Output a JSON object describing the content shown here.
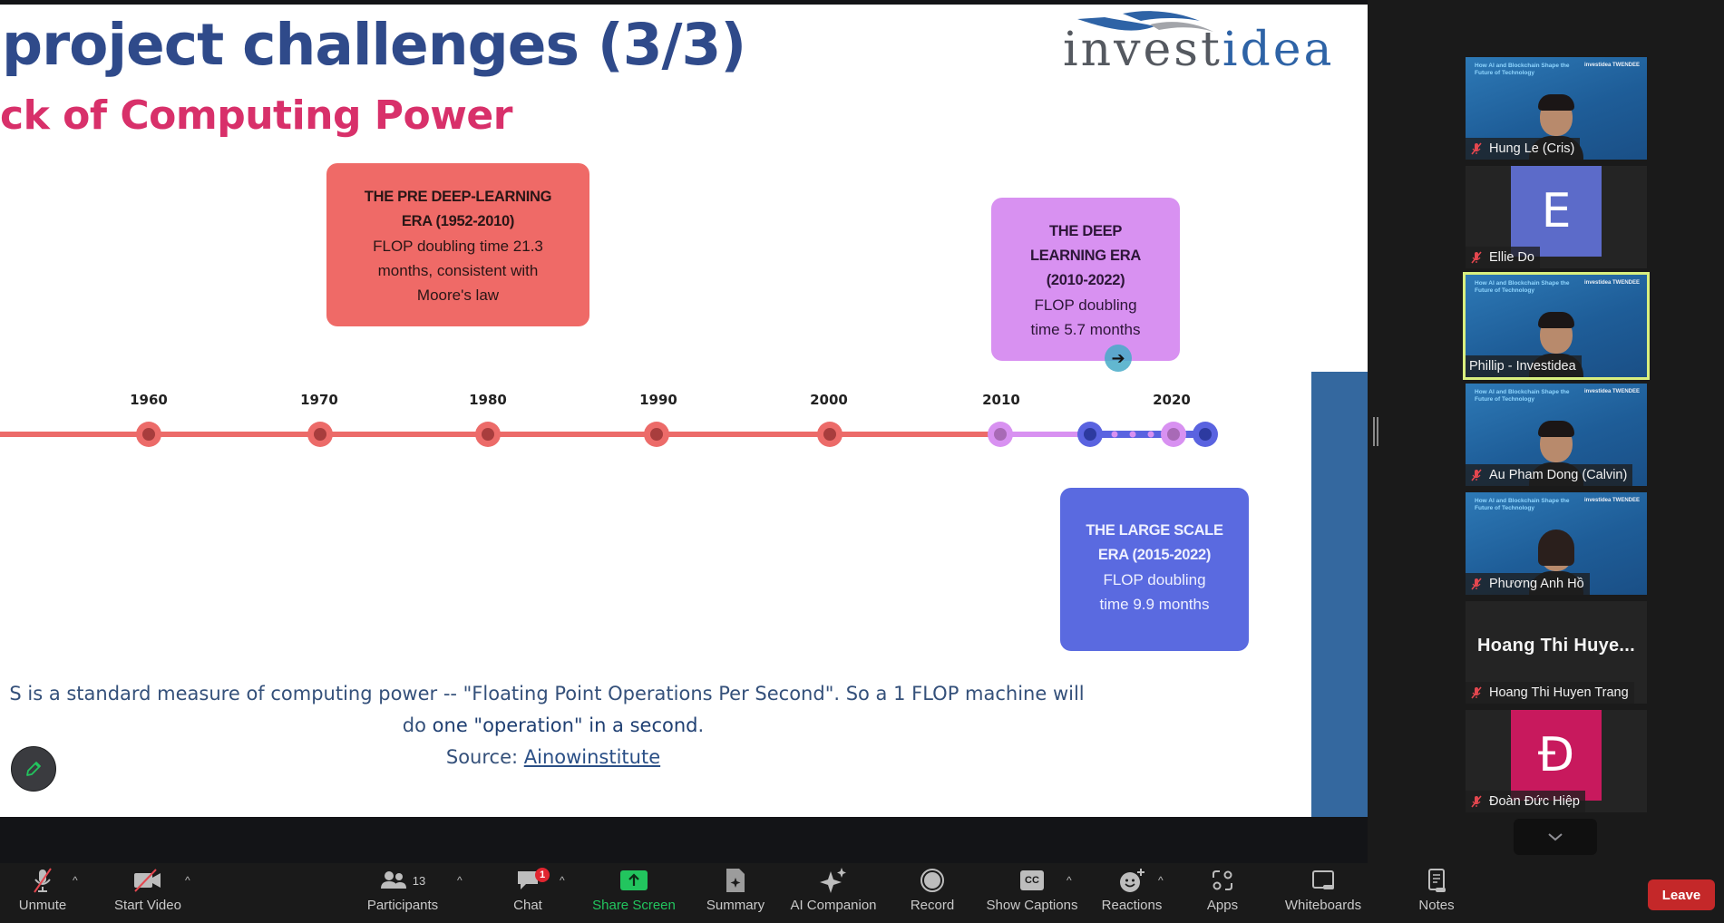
{
  "slide": {
    "title": "project challenges (3/3)",
    "subtitle": "ck of Computing Power",
    "logo": {
      "part1": "invest",
      "part2": "idea"
    },
    "cards": [
      {
        "id": "pre",
        "title_lines": [
          "THE PRE DEEP-LEARNING",
          "ERA (1952-2010)"
        ],
        "body_lines": [
          "FLOP doubling time 21.3",
          "months, consistent with",
          "Moore's law"
        ],
        "color": "#ef6a67"
      },
      {
        "id": "deep",
        "title_lines": [
          "THE DEEP",
          "LEARNING ERA",
          "(2010-2022)"
        ],
        "body_lines": [
          "FLOP doubling",
          "time 5.7 months"
        ],
        "color": "#d891f1"
      },
      {
        "id": "large",
        "title_lines": [
          "THE LARGE SCALE",
          "ERA (2015-2022)"
        ],
        "body_lines": [
          "FLOP doubling",
          "time 9.9 months"
        ],
        "color": "#5a6ae0"
      }
    ],
    "timeline": {
      "years": [
        "1960",
        "1970",
        "1980",
        "1990",
        "2000",
        "2010",
        "2020"
      ],
      "colors": {
        "pre": "#ec6b69",
        "pre_dot": "#a83d3d",
        "deep": "#d891f1",
        "deep_dot": "#a86ab6",
        "large": "#5a63e0",
        "large_dot": "#2d3aa0"
      }
    },
    "footnote": {
      "line1": "S is a standard measure of computing power -- \"Floating Point Operations Per Second\". So a 1 FLOP machine will",
      "line2_pre": "do ",
      "line2_hl": "one \"operation\" in a second",
      "line2_post": ".",
      "source_label": "Source: ",
      "source_link": "Ainowinstitute"
    }
  },
  "gallery": {
    "participants": [
      {
        "name": "Hung Le (Cris)",
        "type": "video",
        "muted": true,
        "active": false
      },
      {
        "name": "Ellie Do",
        "type": "avatar",
        "initial": "E",
        "avatar_color": "#5c6bc9",
        "muted": true,
        "active": false
      },
      {
        "name": "Phillip - Investidea",
        "type": "video",
        "muted": false,
        "active": true
      },
      {
        "name": "Au Pham Dong (Calvin)",
        "type": "video",
        "muted": true,
        "active": false
      },
      {
        "name": "Phương Anh Hồ",
        "type": "video",
        "muted": true,
        "active": false
      },
      {
        "name": "Hoang Thi Huyen Trang",
        "type": "name",
        "display": "Hoang Thi Huye...",
        "muted": true,
        "active": false
      },
      {
        "name": "Đoàn Đức Hiệp",
        "type": "avatar",
        "initial": "Đ",
        "avatar_color": "#c8195d",
        "muted": true,
        "active": false
      }
    ],
    "video_banner": "How AI and Blockchain Shape the Future of Technology",
    "video_brand": "investidea  TWENDEE"
  },
  "toolbar": {
    "unmute": "Unmute",
    "start_video": "Start Video",
    "participants": "Participants",
    "participants_count": "13",
    "chat": "Chat",
    "chat_badge": "1",
    "share_screen": "Share Screen",
    "summary": "Summary",
    "ai_companion": "AI Companion",
    "record": "Record",
    "show_captions": "Show Captions",
    "captions_icon_text": "CC",
    "reactions": "Reactions",
    "apps": "Apps",
    "whiteboards": "Whiteboards",
    "notes": "Notes",
    "leave": "Leave"
  }
}
